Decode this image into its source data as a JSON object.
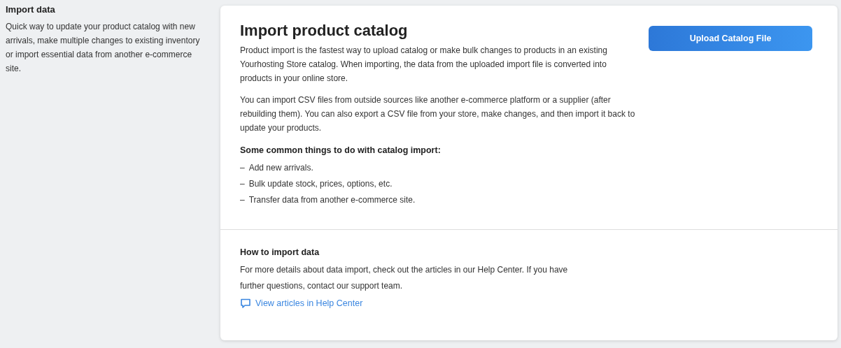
{
  "sidebar": {
    "title": "Import data",
    "description": "Quick way to update your product catalog with new arrivals, make multiple changes to existing inventory or import essential data from another e-commerce site."
  },
  "card": {
    "title": "Import product catalog",
    "button": "Upload Catalog File",
    "paragraphs": [
      "Product import is the fastest way to upload catalog or make bulk changes to products in an existing Yourhosting Store catalog. When importing, the data from the uploaded import file is converted into products in your online store.",
      "You can import CSV files from outside sources like another e-commerce platform or a supplier (after rebuilding them). You can also export a CSV file from your store, make changes, and then import it back to update your products."
    ],
    "list_title": "Some common things to do with catalog import:",
    "list": [
      {
        "marker": "–",
        "text": "Add new arrivals."
      },
      {
        "marker": "–",
        "text": "Bulk update stock, prices, options, etc."
      },
      {
        "marker": "–",
        "text": "Transfer data from another e-commerce site."
      }
    ]
  },
  "help": {
    "title": "How to import data",
    "text": "For more details about data import, check out the articles in our Help Center. If you have further questions, contact our support team.",
    "link": "View articles in Help Center"
  }
}
